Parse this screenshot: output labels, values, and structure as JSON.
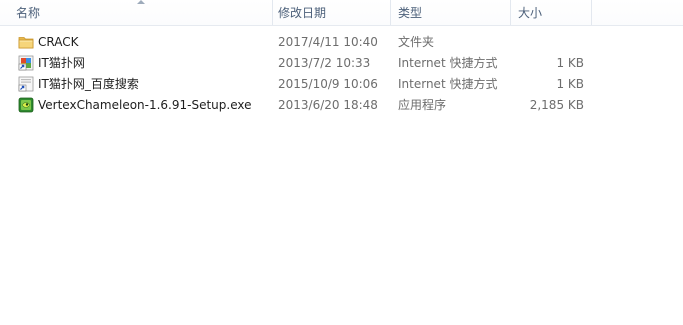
{
  "columns": {
    "name": "名称",
    "date": "修改日期",
    "type": "类型",
    "size": "大小"
  },
  "files": [
    {
      "name": "CRACK",
      "date": "2017/4/11 10:40",
      "type": "文件夹",
      "size": "",
      "icon": "folder-icon"
    },
    {
      "name": "IT猫扑网",
      "date": "2013/7/2 10:33",
      "type": "Internet 快捷方式",
      "size": "1 KB",
      "icon": "internet-shortcut-icon"
    },
    {
      "name": "IT猫扑网_百度搜索",
      "date": "2015/10/9 10:06",
      "type": "Internet 快捷方式",
      "size": "1 KB",
      "icon": "internet-shortcut-icon"
    },
    {
      "name": "VertexChameleon-1.6.91-Setup.exe",
      "date": "2013/6/20 18:48",
      "type": "应用程序",
      "size": "2,185 KB",
      "icon": "installer-icon"
    }
  ]
}
